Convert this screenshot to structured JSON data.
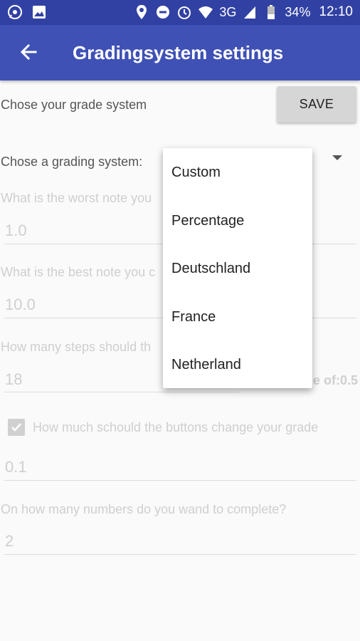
{
  "status_bar": {
    "network": "3G",
    "battery": "34%",
    "time": "12:10"
  },
  "app_bar": {
    "title": "Gradingsystem settings"
  },
  "content": {
    "chose_label": "Chose your grade system",
    "save_label": "SAVE",
    "grading_system_label": "Chose a grading system:",
    "worst_note_label": "What is the worst note you",
    "worst_note_value": "1.0",
    "best_note_label": "What is the best note you c",
    "best_note_value": "10.0",
    "steps_label": "How many steps should th",
    "steps_value": "18",
    "steps_right_text": "e of:0.5",
    "buttons_change_label": "How much schould the buttons change your grade",
    "buttons_change_value": "0.1",
    "complete_label": "On how many numbers do you wand to complete?",
    "complete_value": "2"
  },
  "dropdown": {
    "items": [
      "Custom",
      "Percentage",
      "Deutschland",
      "France",
      "Netherland"
    ]
  }
}
